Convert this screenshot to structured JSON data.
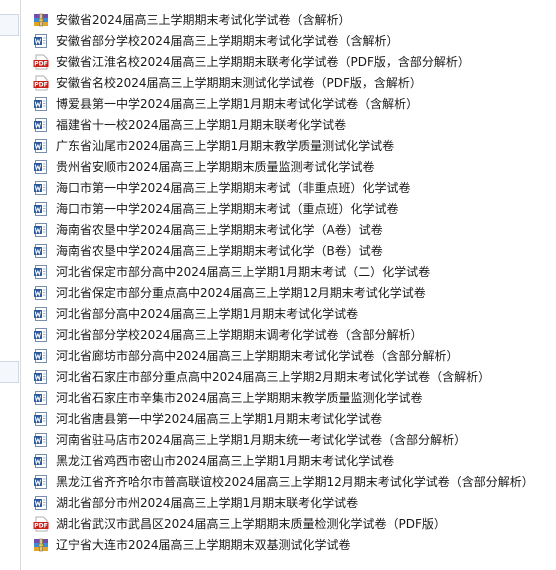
{
  "files": [
    {
      "icon": "archive-icon",
      "name": "安徽省2024届高三上学期期末考试化学试卷（含解析）"
    },
    {
      "icon": "word-doc-icon",
      "name": "安徽省部分学校2024届高三上学期期末考试化学试卷（含解析）"
    },
    {
      "icon": "pdf-icon",
      "name": "安徽省江淮名校2024届高三上学期期末联考化学试卷（PDF版，含部分解析）"
    },
    {
      "icon": "pdf-icon",
      "name": "安徽省名校2024届高三上学期期末测试化学试卷（PDF版，含解析）"
    },
    {
      "icon": "word-doc-icon",
      "name": "博爱县第一中学2024届高三上学期1月期末考试化学试卷（含解析）"
    },
    {
      "icon": "word-doc-icon",
      "name": "福建省十一校2024届高三上学期1月期末联考化学试卷"
    },
    {
      "icon": "word-doc-icon",
      "name": "广东省汕尾市2024届高三上学期1月期末教学质量测试化学试卷"
    },
    {
      "icon": "word-doc-icon",
      "name": "贵州省安顺市2024届高三上学期期末质量监测考试化学试卷"
    },
    {
      "icon": "word-doc-icon",
      "name": "海口市第一中学2024届高三上学期期末考试（非重点班）化学试卷"
    },
    {
      "icon": "word-doc-icon",
      "name": "海口市第一中学2024届高三上学期期末考试（重点班）化学试卷"
    },
    {
      "icon": "word-doc-icon",
      "name": "海南省农垦中学2024届高三上学期期末考试化学（A卷）试卷"
    },
    {
      "icon": "word-doc-icon",
      "name": "海南省农垦中学2024届高三上学期期末考试化学（B卷）试卷"
    },
    {
      "icon": "word-doc-icon",
      "name": "河北省保定市部分高中2024届高三上学期1月期末考试（二）化学试卷"
    },
    {
      "icon": "word-doc-icon",
      "name": "河北省保定市部分重点高中2024届高三上学期12月期末考试化学试卷"
    },
    {
      "icon": "word-doc-icon",
      "name": "河北省部分高中2024届高三上学期1月期末考试化学试卷"
    },
    {
      "icon": "word-doc-icon",
      "name": "河北省部分学校2024届高三上学期期末调考化学试卷（含部分解析）"
    },
    {
      "icon": "word-doc-icon",
      "name": "河北省廊坊市部分高中2024届高三上学期期末考试化学试卷（含部分解析）"
    },
    {
      "icon": "word-doc-icon",
      "name": "河北省石家庄市部分重点高中2024届高三上学期2月期末考试化学试卷（含解析）"
    },
    {
      "icon": "word-doc-icon",
      "name": "河北省石家庄市辛集市2024届高三上学期期末教学质量监测化学试卷"
    },
    {
      "icon": "word-doc-icon",
      "name": "河北省唐县第一中学2024届高三上学期1月期末考试化学试卷"
    },
    {
      "icon": "word-doc-icon",
      "name": "河南省驻马店市2024届高三上学期1月期末统一考试化学试卷（含部分解析）"
    },
    {
      "icon": "word-doc-icon",
      "name": "黑龙江省鸡西市密山市2024届高三上学期1月期末考试化学试卷"
    },
    {
      "icon": "word-doc-icon",
      "name": "黑龙江省齐齐哈尔市普高联谊校2024届高三上学期12月期末考试化学试卷（含部分解析）"
    },
    {
      "icon": "word-doc-icon",
      "name": "湖北省部分市州2024届高三上学期1月期末联考化学试卷"
    },
    {
      "icon": "pdf-icon",
      "name": "湖北省武汉市武昌区2024届高三上学期期末质量检测化学试卷（PDF版）"
    },
    {
      "icon": "archive-icon",
      "name": "辽宁省大连市2024届高三上学期期末双基测试化学试卷"
    }
  ]
}
